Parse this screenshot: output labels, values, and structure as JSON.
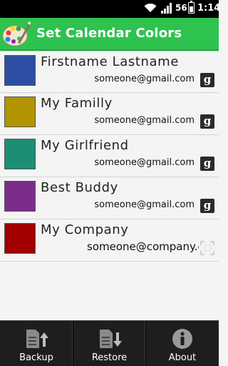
{
  "status_bar": {
    "network_type": "56",
    "time": "1:14",
    "icons": [
      "wifi-icon",
      "signal-icon",
      "battery-icon"
    ]
  },
  "header": {
    "title": "Set Calendar Colors",
    "icon": "app-palette-icon",
    "background_color": "#2ec24f"
  },
  "calendars": [
    {
      "name": "Firstname Lastname",
      "email": "someone@gmail.com",
      "color": "#2d4ea3",
      "account_icon": "google-icon"
    },
    {
      "name": "My Familly",
      "email": "someone@gmail.com",
      "color": "#b29400",
      "account_icon": "google-icon"
    },
    {
      "name": "My Girlfriend",
      "email": "someone@gmail.com",
      "color": "#1c8e76",
      "account_icon": "google-icon"
    },
    {
      "name": "Best Buddy",
      "email": "someone@gmail.com",
      "color": "#7b2d8a",
      "account_icon": "google-icon"
    },
    {
      "name": "My Company",
      "email": "someone@company.com",
      "color": "#a00000",
      "account_icon": "sync-icon"
    }
  ],
  "google_badge_glyph": "g",
  "bottom_bar": {
    "buttons": [
      {
        "label": "Backup",
        "icon": "backup-icon"
      },
      {
        "label": "Restore",
        "icon": "restore-icon"
      },
      {
        "label": "About",
        "icon": "info-icon"
      }
    ]
  }
}
